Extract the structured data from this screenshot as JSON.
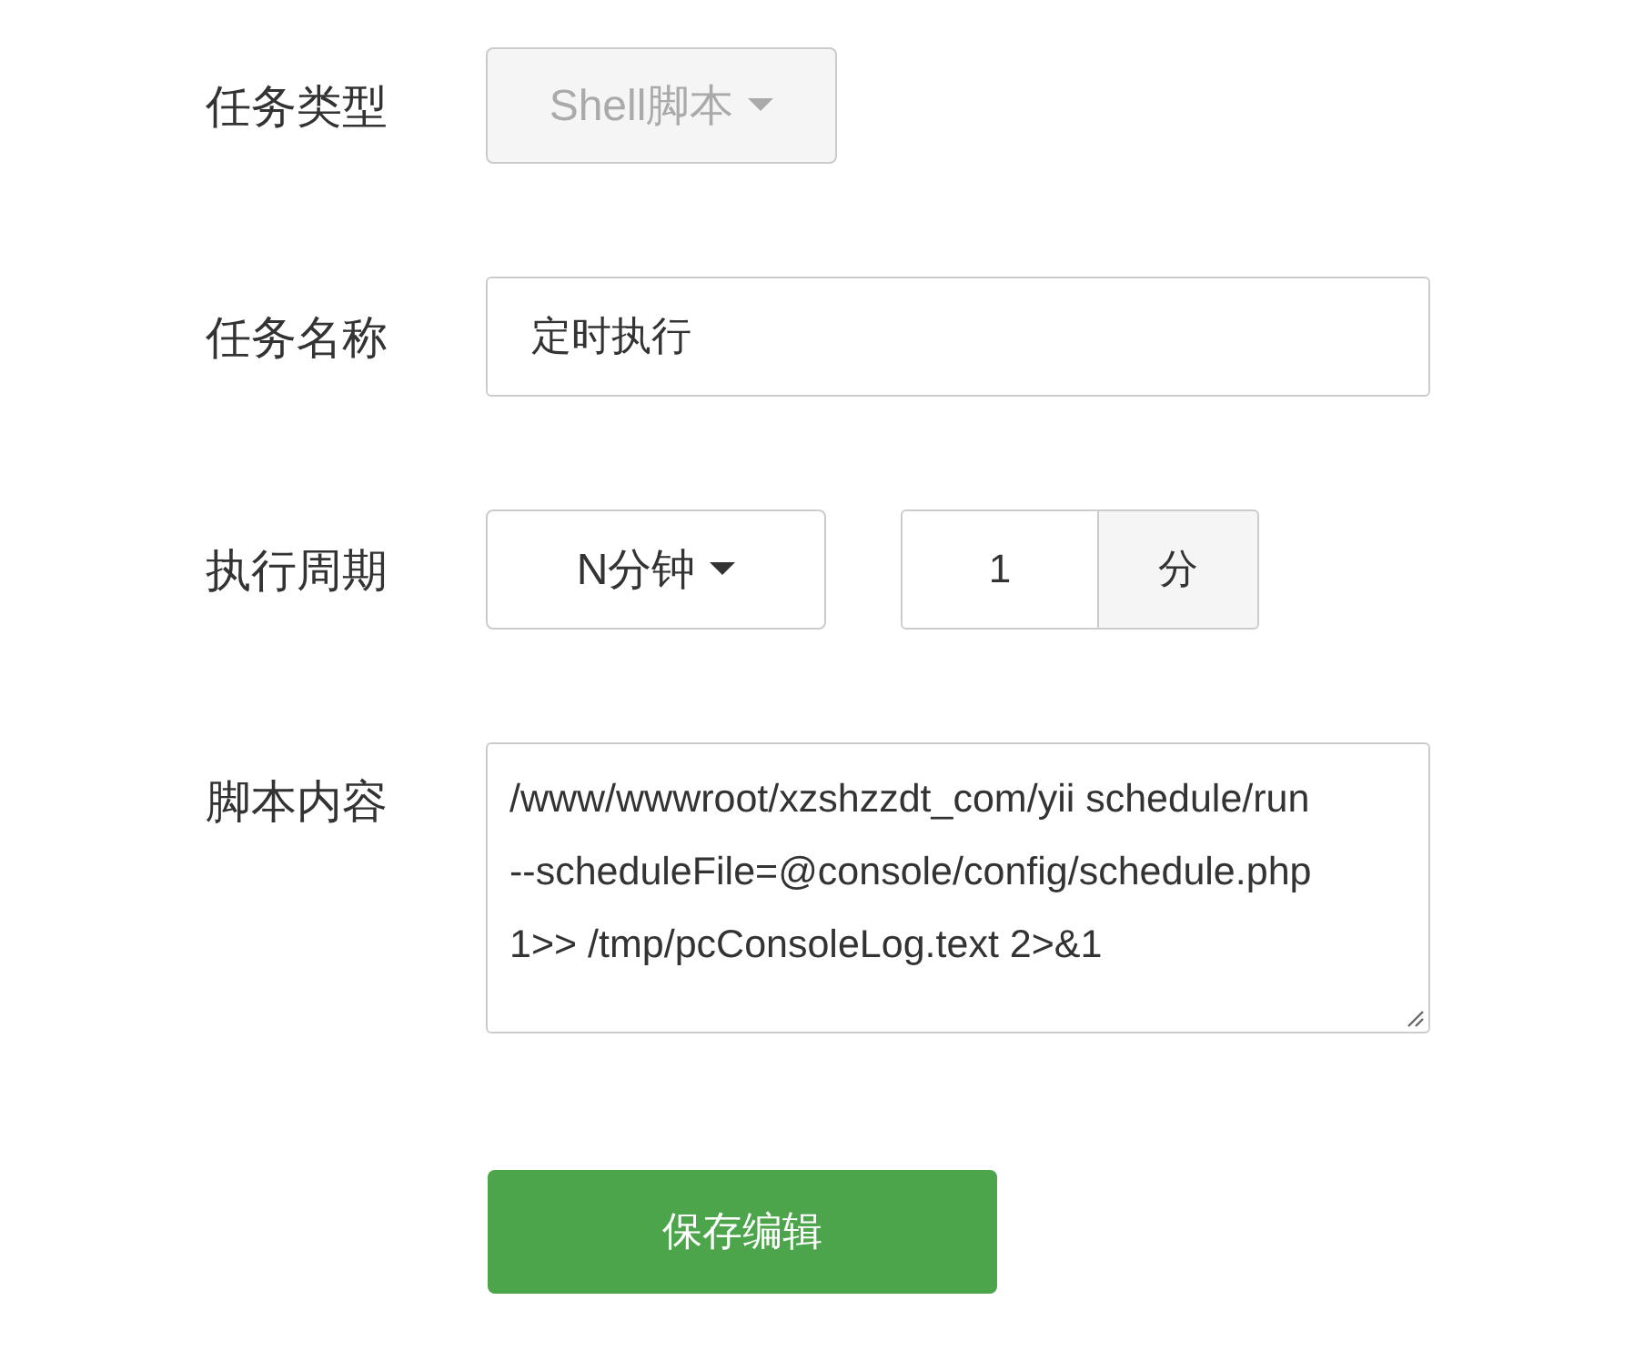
{
  "form": {
    "rows": [
      {
        "kind": "select",
        "label": "任务类型",
        "value": "Shell脚本",
        "disabled": true
      },
      {
        "kind": "text",
        "label": "任务名称",
        "value": "定时执行"
      },
      {
        "kind": "period",
        "label": "执行周期",
        "value": "N分钟",
        "disabled": false,
        "number": "1",
        "unit": "分"
      },
      {
        "kind": "textarea",
        "label": "脚本内容",
        "value": "/www/wwwroot/xzshzzdt_com/yii schedule/run\n--scheduleFile=@console/config/schedule.php\n1>> /tmp/pcConsoleLog.text 2>&1"
      }
    ]
  },
  "save_button": "保存编辑"
}
